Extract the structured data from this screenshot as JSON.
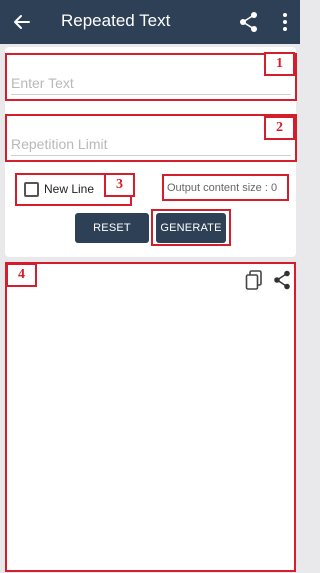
{
  "appbar": {
    "title": "Repeated Text",
    "back_icon": "arrow-left-icon",
    "share_icon": "share-icon",
    "more_icon": "more-vert-icon",
    "color": "#2e4056"
  },
  "form": {
    "text_input": {
      "placeholder": "Enter Text",
      "value": ""
    },
    "limit_input": {
      "placeholder": "Repetition Limit",
      "value": ""
    },
    "new_line": {
      "label": "New Line",
      "checked": false
    },
    "output_size": "Output content size : 0",
    "reset_label": "RESET",
    "generate_label": "GENERATE"
  },
  "annotations": [
    "1",
    "2",
    "3",
    "4"
  ],
  "output_panel": {
    "copy_icon": "copy-icon",
    "share_icon": "share-icon"
  },
  "colors": {
    "highlight": "#d51e2b",
    "primary": "#2e4056"
  }
}
